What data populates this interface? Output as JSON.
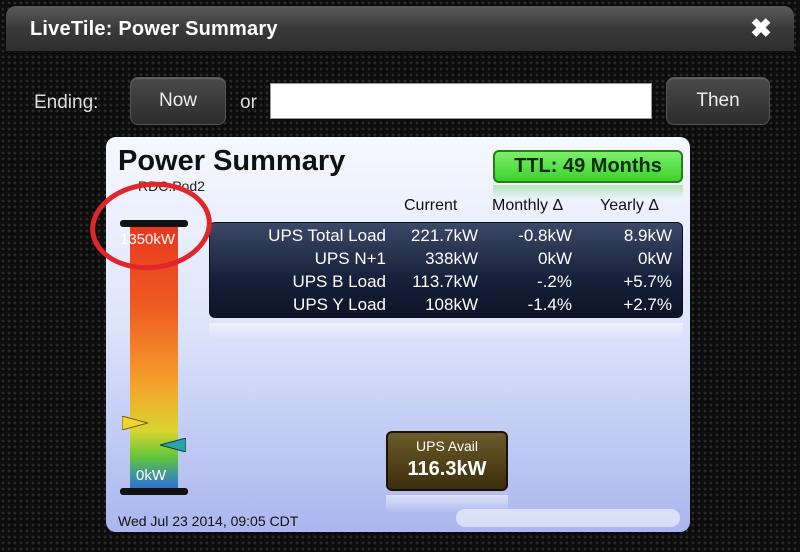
{
  "window": {
    "title": "LiveTile: Power Summary",
    "close_glyph": "✖"
  },
  "controls": {
    "ending_label": "Ending:",
    "now_button": "Now",
    "or_label": "or",
    "date_value": "",
    "then_button": "Then"
  },
  "panel": {
    "title": "Power Summary",
    "subtitle": "RDC:Pod2",
    "ttl": "TTL: 49 Months",
    "columns": [
      "Current",
      "Monthly Δ",
      "Yearly Δ"
    ],
    "rows": [
      {
        "name": "UPS Total Load",
        "current": "221.7kW",
        "monthly": "-0.8kW",
        "yearly": "8.9kW"
      },
      {
        "name": "UPS N+1",
        "current": "338kW",
        "monthly": "0kW",
        "yearly": "0kW"
      },
      {
        "name": "UPS B Load",
        "current": "113.7kW",
        "monthly": "-.2%",
        "yearly": "+5.7%"
      },
      {
        "name": "UPS Y Load",
        "current": "108kW",
        "monthly": "-1.4%",
        "yearly": "+2.7%"
      }
    ],
    "gauge": {
      "max_label": "1350kW",
      "min_label": "0kW"
    },
    "avail": {
      "label": "UPS Avail",
      "value": "116.3kW"
    },
    "timestamp": "Wed Jul 23 2014, 09:05 CDT"
  },
  "colors": {
    "ttl_green": "#3bd22c",
    "annotation_red": "#e0262b",
    "marker_teal": "#2aa3a8",
    "marker_yellow": "#f2d230"
  },
  "icons": {
    "close": "close-icon",
    "load_marker": "triangle-marker-icon"
  }
}
